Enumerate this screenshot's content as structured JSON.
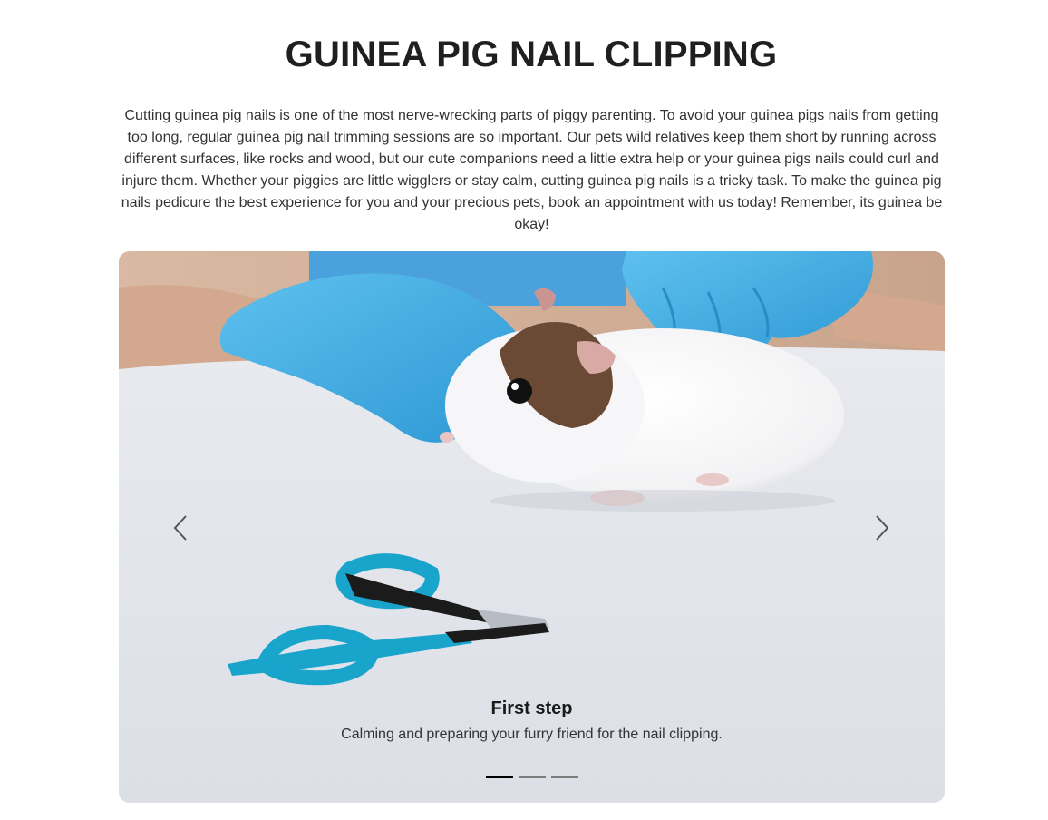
{
  "page": {
    "title": "GUINEA PIG NAIL CLIPPING",
    "intro": "Cutting guinea pig nails is one of the most nerve-wrecking parts of piggy parenting. To avoid your guinea pigs nails from getting too long, regular guinea pig nail trimming sessions are so important. Our pets wild relatives keep them short by running across different surfaces, like rocks and wood, but our cute companions need a little extra help or your guinea pigs nails could curl and injure them. Whether your piggies are little wigglers or stay calm, cutting guinea pig nails is a tricky task. To make the guinea pig nails pedicure the best experience for you and your precious pets, book an appointment with us today! Remember, its guinea be okay!"
  },
  "carousel": {
    "active_index": 0,
    "slide_count": 3,
    "slides": [
      {
        "title": "First step",
        "text": "Calming and preparing your furry friend for the nail clipping."
      }
    ],
    "controls": {
      "prev_icon": "chevron-left-icon",
      "next_icon": "chevron-right-icon"
    }
  },
  "colors": {
    "glove": "#3aa9e0",
    "clipper_handle": "#1aa5cc",
    "indicator_active": "#000000",
    "indicator_inactive": "#7b7b7b"
  }
}
